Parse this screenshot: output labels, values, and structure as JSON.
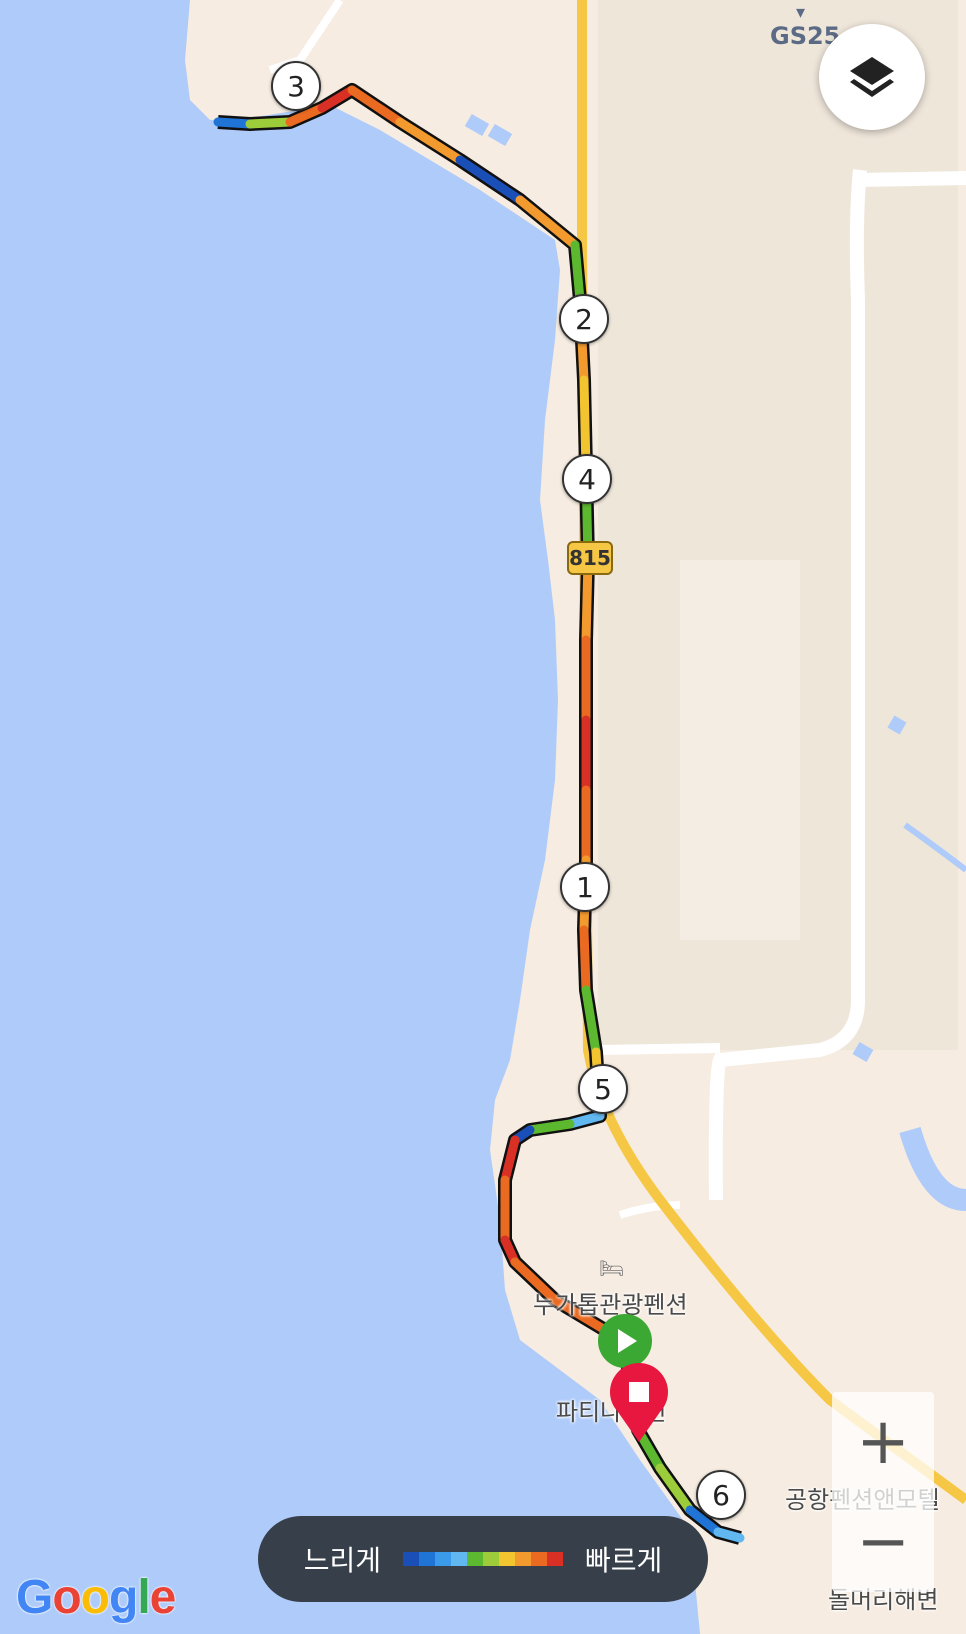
{
  "map": {
    "colors": {
      "water": "#aecbfa",
      "land": "#f6ece1",
      "highway": "#f6c744",
      "minor_road": "#ffffff"
    },
    "route_markers": [
      "1",
      "2",
      "3",
      "4",
      "5",
      "6"
    ],
    "pois": [
      {
        "label": "GS25",
        "icon": "convenience-store-icon"
      },
      {
        "label": "누가톱관광펜션",
        "icon": "hotel-icon"
      },
      {
        "label": "파티나펜션",
        "icon": "hotel-icon"
      },
      {
        "label": "공항펜션앤모텔",
        "icon": "hotel-icon"
      },
      {
        "label": "돌머리해변",
        "icon": "beach-icon"
      }
    ],
    "road_shield": "815",
    "start_marker": "play-icon",
    "end_marker": "stop-icon"
  },
  "controls": {
    "layers_icon": "layers-icon",
    "zoom_in_label": "+",
    "zoom_out_label": "−"
  },
  "legend": {
    "slow_label": "느리게",
    "fast_label": "빠르게",
    "colors": [
      "#1a4fb8",
      "#1f74d6",
      "#3b9bea",
      "#61b8f0",
      "#5cb82e",
      "#9ccc3a",
      "#f2c430",
      "#f29a2e",
      "#ea6a22",
      "#d93025"
    ]
  },
  "attribution": "Google"
}
